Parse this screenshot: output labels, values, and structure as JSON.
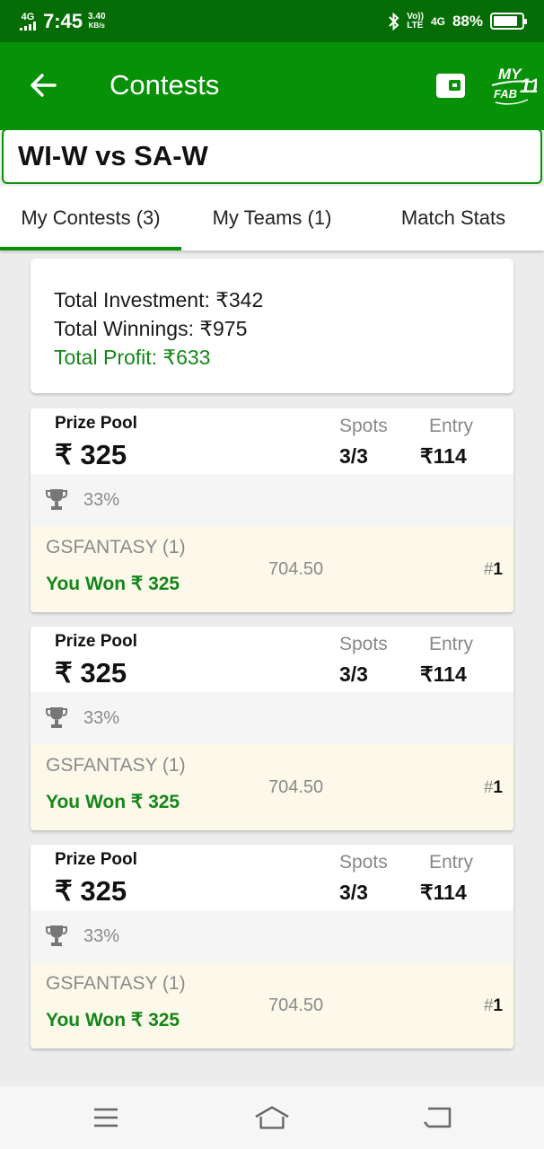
{
  "status_bar": {
    "network": "4G",
    "time": "7:45",
    "speed_value": "3.40",
    "speed_unit": "KB/s",
    "volte_top": "Vo))",
    "volte_bottom": "LTE",
    "network_right": "4G",
    "battery_pct": "88%",
    "battery_level": 0.88,
    "icons": [
      "signal-icon",
      "bluetooth-icon",
      "battery-icon"
    ]
  },
  "app_bar": {
    "title": "Contests",
    "back_icon": "back-arrow-icon",
    "wallet_icon": "wallet-icon",
    "logo_text_top": "MY",
    "logo_text_bottom": "FAB",
    "logo_number": "11"
  },
  "match": {
    "title": "WI-W vs SA-W"
  },
  "tabs": [
    {
      "label": "My Contests (3)",
      "active": true
    },
    {
      "label": "My Teams (1)",
      "active": false
    },
    {
      "label": "Match Stats",
      "active": false
    }
  ],
  "summary": {
    "investment": "Total Investment: ₹342",
    "winnings": "Total Winnings: ₹975",
    "profit": "Total Profit: ₹633"
  },
  "contests": [
    {
      "prize_label": "Prize Pool",
      "prize_amount": "₹ 325",
      "spots_label": "Spots",
      "spots_value": "3/3",
      "entry_label": "Entry",
      "entry_value": "₹114",
      "win_pct": "33%",
      "team_name": "GSFANTASY (1)",
      "won_text": "You Won ₹ 325",
      "points": "704.50",
      "rank_prefix": "#",
      "rank_value": "1"
    },
    {
      "prize_label": "Prize Pool",
      "prize_amount": "₹ 325",
      "spots_label": "Spots",
      "spots_value": "3/3",
      "entry_label": "Entry",
      "entry_value": "₹114",
      "win_pct": "33%",
      "team_name": "GSFANTASY (1)",
      "won_text": "You Won ₹ 325",
      "points": "704.50",
      "rank_prefix": "#",
      "rank_value": "1"
    },
    {
      "prize_label": "Prize Pool",
      "prize_amount": "₹ 325",
      "spots_label": "Spots",
      "spots_value": "3/3",
      "entry_label": "Entry",
      "entry_value": "₹114",
      "win_pct": "33%",
      "team_name": "GSFANTASY (1)",
      "won_text": "You Won ₹ 325",
      "points": "704.50",
      "rank_prefix": "#",
      "rank_value": "1"
    }
  ],
  "nav": {
    "icons": [
      "menu-icon",
      "home-icon",
      "back-icon"
    ]
  },
  "colors": {
    "status_bar": "#066d06",
    "app_bar": "#079107",
    "profit_green": "#14861a",
    "won_bg": "#fdf9ea"
  }
}
